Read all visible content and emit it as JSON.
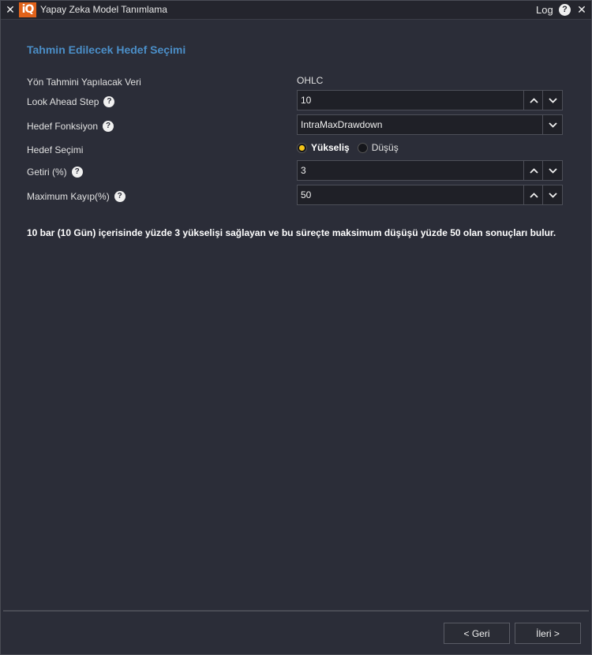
{
  "window": {
    "title": "Yapay Zeka Model Tanımlama",
    "logo_text": "iQ",
    "log_label": "Log",
    "help_label": "?"
  },
  "section": {
    "title": "Tahmin Edilecek Hedef Seçimi"
  },
  "form": {
    "data_label": "Yön Tahmini Yapılacak Veri",
    "data_value": "OHLC",
    "look_ahead_label": "Look Ahead Step",
    "look_ahead_value": "10",
    "target_func_label": "Hedef Fonksiyon",
    "target_func_value": "IntraMaxDrawdown",
    "target_select_label": "Hedef Seçimi",
    "radio_up_label": "Yükseliş",
    "radio_down_label": "Düşüş",
    "radio_selected": "up",
    "return_label": "Getiri (%)",
    "return_value": "3",
    "max_loss_label": "Maximum Kayıp(%)",
    "max_loss_value": "50"
  },
  "summary": {
    "text": "10 bar (10 Gün) içerisinde yüzde 3 yükselişi sağlayan ve bu süreçte maksimum düşüşü yüzde 50 olan sonuçları bulur."
  },
  "footer": {
    "back_label": "< Geri",
    "next_label": "İleri >"
  },
  "colors": {
    "accent": "#4b8ec7",
    "logo": "#e0621a",
    "radio_selected": "#f5c518",
    "background": "#2b2d38"
  }
}
